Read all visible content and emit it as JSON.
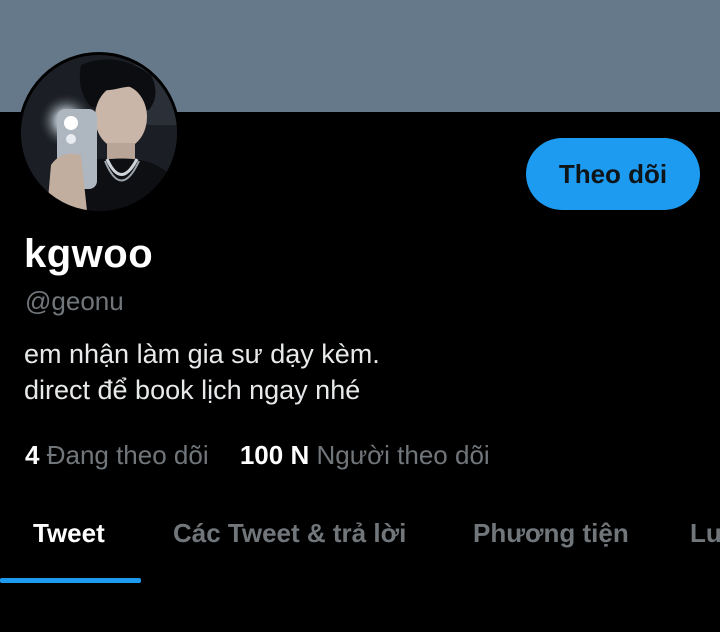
{
  "profile": {
    "display_name": "kgwoo",
    "handle": "@geonu",
    "bio_line1": "em nhận làm gia sư dạy kèm.",
    "bio_line2": "direct để book lịch ngay nhé",
    "follow_label": "Theo dõi"
  },
  "stats": {
    "following_count": "4",
    "following_label": "Đang theo dõi",
    "followers_count": "100 N",
    "followers_label": "Người theo dõi"
  },
  "tabs": [
    {
      "label": "Tweet",
      "active": true
    },
    {
      "label": "Các Tweet & trả lời",
      "active": false
    },
    {
      "label": "Phương tiện",
      "active": false
    },
    {
      "label": "Lư",
      "active": false
    }
  ],
  "colors": {
    "banner": "#66798a",
    "accent": "#1d9bf0",
    "background": "#000000",
    "secondary_text": "#71767b"
  }
}
